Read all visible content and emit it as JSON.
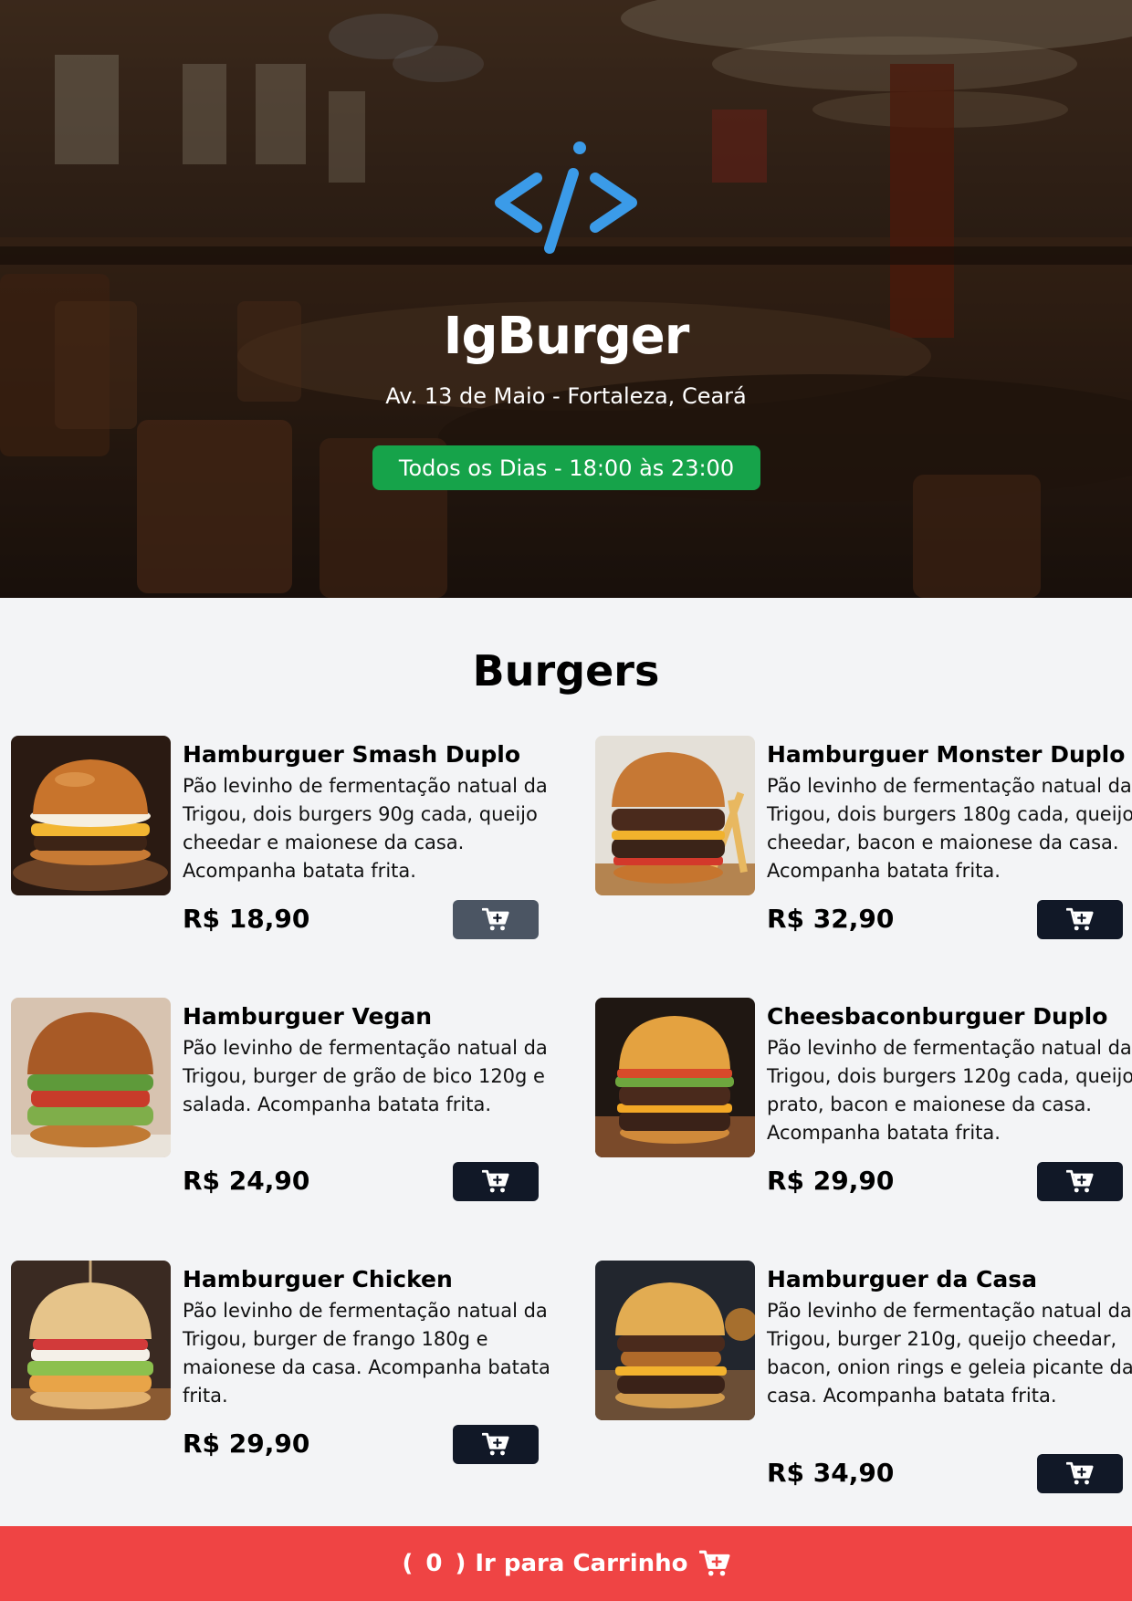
{
  "header": {
    "title": "IgBurger",
    "address": "Av. 13 de Maio - Fortaleza, Ceará",
    "hours": "Todos os Dias - 18:00 às 23:00",
    "logo_icon": "code-brackets-icon",
    "hours_color": "#16a34a"
  },
  "menu": {
    "section_title": "Burgers",
    "items": [
      {
        "name": "Hamburguer Smash Duplo",
        "description": "Pão levinho de fermentação natual da Trigou, dois burgers 90g cada, queijo cheedar e maionese da casa. Acompanha batata frita.",
        "price": "R$ 18,90"
      },
      {
        "name": "Hamburguer Monster Duplo",
        "description": "Pão levinho de fermentação natual da Trigou, dois burgers 180g cada, queijo cheedar, bacon e maionese da casa. Acompanha batata frita.",
        "price": "R$ 32,90"
      },
      {
        "name": "Hamburguer Vegan",
        "description": "Pão levinho de fermentação natual da Trigou, burger de grão de bico 120g e salada. Acompanha batata frita.",
        "price": "R$ 24,90"
      },
      {
        "name": "Cheesbaconburguer Duplo",
        "description": "Pão levinho de fermentação natual da Trigou, dois burgers 120g cada, queijo prato, bacon e maionese da casa. Acompanha batata frita.",
        "price": "R$ 29,90"
      },
      {
        "name": "Hamburguer Chicken",
        "description": "Pão levinho de fermentação natual da Trigou, burger de frango 180g e maionese da casa. Acompanha batata frita.",
        "price": "R$ 29,90"
      },
      {
        "name": "Hamburguer da Casa",
        "description": "Pão levinho de fermentação natual da Trigou, burger 210g, queijo cheedar, bacon, onion rings e geleia picante da casa. Acompanha batata frita.",
        "price": "R$ 34,90"
      }
    ]
  },
  "footer": {
    "open_paren": "(",
    "cart_count": "0",
    "close_paren": ")",
    "label": "Ir para Carrinho",
    "icon": "cart-plus-icon",
    "color": "#ef4444"
  },
  "colors": {
    "button_bg": "#111827",
    "button_hover_bg": "#4b5563",
    "page_bg": "#f3f4f6"
  }
}
